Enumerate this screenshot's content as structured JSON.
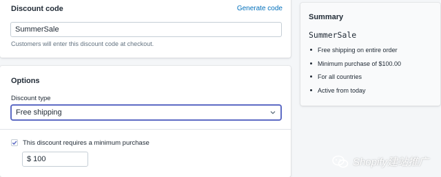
{
  "discount_code": {
    "title": "Discount code",
    "generate_link": "Generate code",
    "value": "SummerSale",
    "help_text": "Customers will enter this discount code at checkout."
  },
  "options": {
    "title": "Options",
    "discount_type_label": "Discount type",
    "discount_type_value": "Free shipping",
    "min_purchase_checkbox_label": "This discount requires a minimum purchase",
    "min_purchase_checked": true,
    "min_purchase_value": "$ 100"
  },
  "summary": {
    "title": "Summary",
    "code": "SummerSale",
    "items": [
      "Free shipping on entire order",
      "Minimum purchase of $100.00",
      "For all countries",
      "Active from today"
    ]
  },
  "watermark": {
    "text": "Shopify建站推广"
  },
  "colors": {
    "accent": "#5c6ac4",
    "link": "#006fbb",
    "background": "#f4f6f8"
  },
  "icons": {
    "select": "chevron-down-icon",
    "checkbox": "checkmark-icon",
    "watermark": "wechat-icon"
  }
}
